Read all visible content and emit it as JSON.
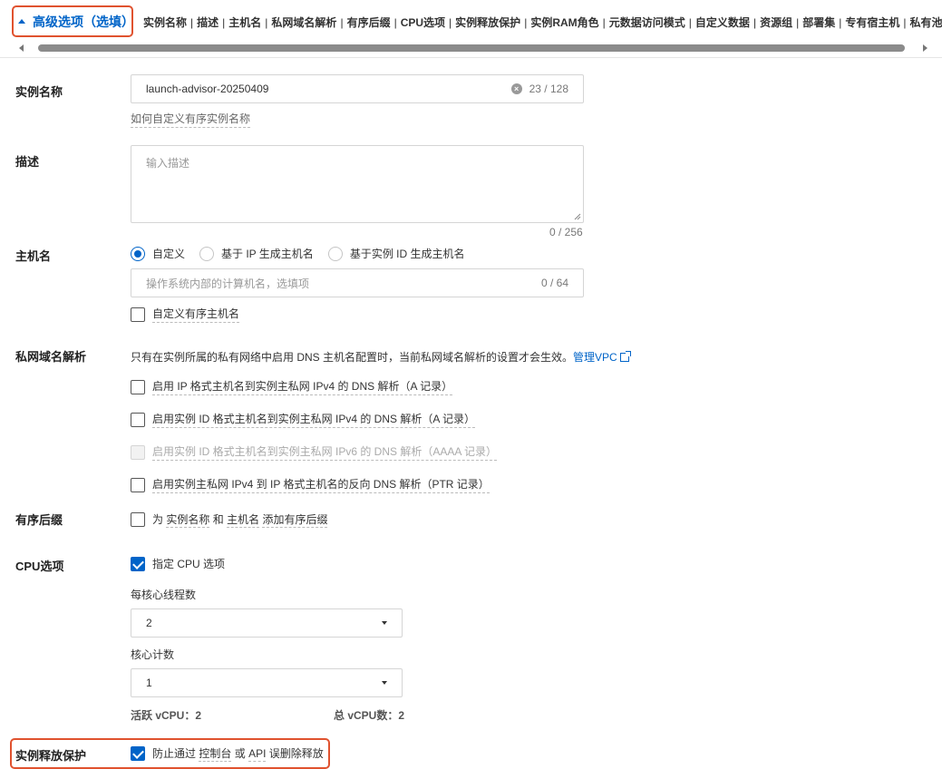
{
  "header": {
    "advanced_toggle_label": "高级选项（选填）",
    "nav_links": [
      "实例名称",
      "描述",
      "主机名",
      "私网域名解析",
      "有序后缀",
      "CPU选项",
      "实例释放保护",
      "实例RAM角色",
      "元数据访问模式",
      "自定义数据",
      "资源组",
      "部署集",
      "专有宿主机",
      "私有池类"
    ],
    "separator": "|"
  },
  "instance_name": {
    "label": "实例名称",
    "value": "launch-advisor-20250409",
    "counter": "23 / 128",
    "hint": "如何自定义有序实例名称"
  },
  "description": {
    "label": "描述",
    "placeholder": "输入描述",
    "counter": "0 / 256"
  },
  "hostname": {
    "label": "主机名",
    "options": [
      "自定义",
      "基于 IP 生成主机名",
      "基于实例 ID 生成主机名"
    ],
    "selected": "自定义",
    "placeholder": "操作系统内部的计算机名，选填项",
    "counter": "0 / 64",
    "ordered_checkbox": "自定义有序主机名"
  },
  "private_dns": {
    "label": "私网域名解析",
    "note": "只有在实例所属的私有网络中启用 DNS 主机名配置时，当前私网域名解析的设置才会生效。",
    "manage_link": "管理VPC",
    "options": [
      {
        "label": "启用 IP 格式主机名到实例主私网 IPv4 的 DNS 解析（A 记录）",
        "checked": false,
        "disabled": false
      },
      {
        "label": "启用实例 ID 格式主机名到实例主私网 IPv4 的 DNS 解析（A 记录）",
        "checked": false,
        "disabled": false
      },
      {
        "label": "启用实例 ID 格式主机名到实例主私网 IPv6 的 DNS 解析（AAAA 记录）",
        "checked": false,
        "disabled": true
      },
      {
        "label": "启用实例主私网 IPv4 到 IP 格式主机名的反向 DNS 解析（PTR 记录）",
        "checked": false,
        "disabled": false
      }
    ]
  },
  "ordered_suffix": {
    "label": "有序后缀",
    "text_prefix": "为",
    "text_name": "实例名称",
    "text_and": "和",
    "text_host": "主机名",
    "text_suffix": "添加有序后缀"
  },
  "cpu_options": {
    "label": "CPU选项",
    "checkbox": "指定 CPU 选项",
    "checked": true,
    "threads_label": "每核心线程数",
    "threads_value": "2",
    "cores_label": "核心计数",
    "cores_value": "1",
    "active_vcpu": "活跃 vCPU：2",
    "total_vcpu": "总 vCPU数：2"
  },
  "release_protection": {
    "label": "实例释放保护",
    "checkbox_prefix": "防止通过",
    "checkbox_console": "控制台",
    "checkbox_or": "或",
    "checkbox_api": "API",
    "checkbox_suffix": "误删除释放",
    "checked": true
  },
  "colors": {
    "primary": "#0064c8",
    "highlight": "#e0522f"
  }
}
